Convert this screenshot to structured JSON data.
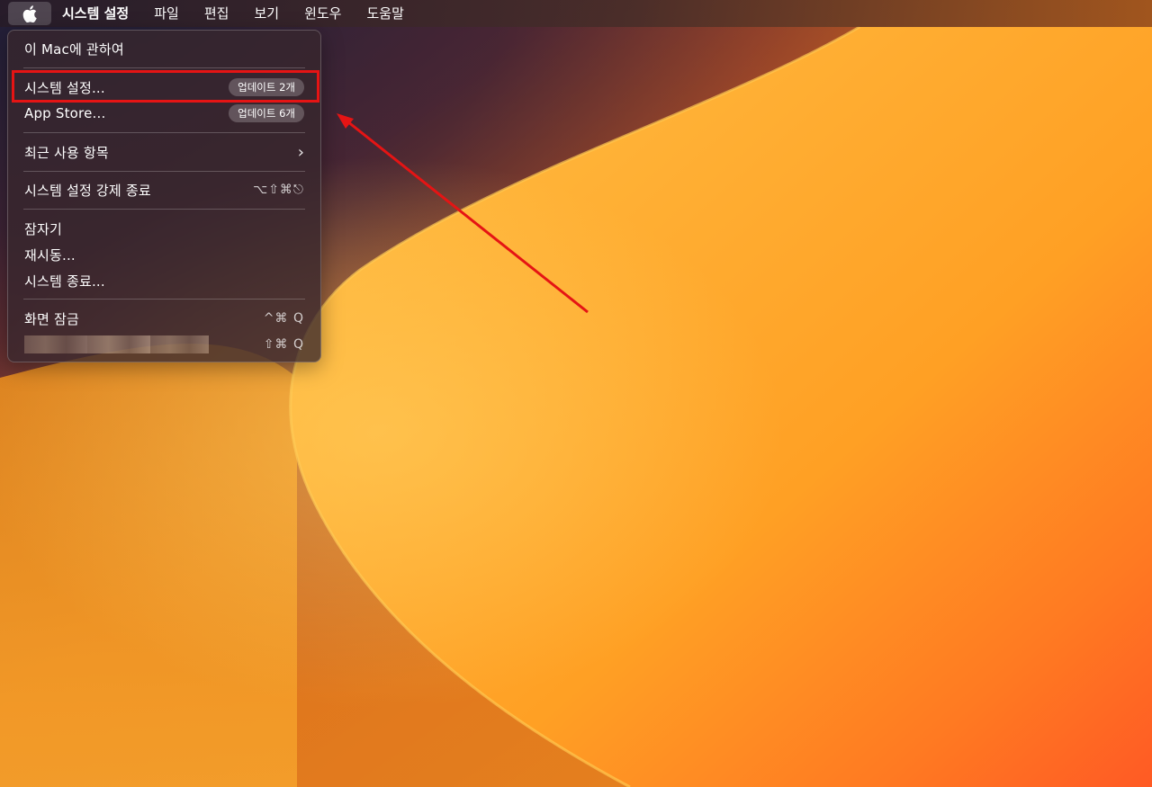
{
  "menubar": {
    "app_name": "시스템 설정",
    "items": [
      "파일",
      "편집",
      "보기",
      "윈도우",
      "도움말"
    ]
  },
  "apple_menu": {
    "about": "이 Mac에 관하여",
    "system_settings": {
      "label": "시스템 설정...",
      "badge": "업데이트 2개"
    },
    "app_store": {
      "label": "App Store...",
      "badge": "업데이트 6개"
    },
    "recent_items": "최근 사용 항목",
    "force_quit": {
      "label": "시스템 설정 강제 종료",
      "shortcut": "⌥⇧⌘⎋"
    },
    "sleep": "잠자기",
    "restart": "재시동...",
    "shutdown": "시스템 종료...",
    "lock_screen": {
      "label": "화면 잠금",
      "shortcut": "^⌘ Q"
    },
    "logout": {
      "shortcut": "⇧⌘ Q"
    }
  },
  "icons": {
    "apple": "apple-logo-icon",
    "chevron": "chevron-right-icon"
  },
  "colors": {
    "highlight": "#e51414",
    "arrow": "#e51414"
  }
}
